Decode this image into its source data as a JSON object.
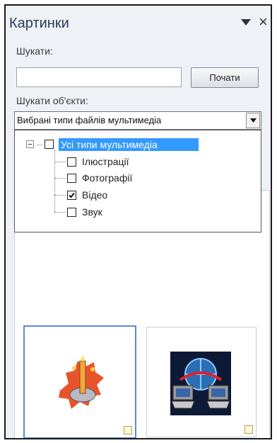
{
  "panel": {
    "title": "Картинки",
    "menu_icon": "chevron-down-icon",
    "close_icon": "close-icon",
    "close_glyph": "×"
  },
  "search": {
    "label": "Шукати:",
    "value": "",
    "placeholder": "",
    "go_button": "Почати"
  },
  "objects": {
    "label": "Шукати об'єкти:",
    "selected": "Вибрані типи файлів мультимедіа"
  },
  "tree": {
    "root": {
      "label": "Усі типи мультимедіа",
      "checked": false,
      "expanded": true,
      "selected": true
    },
    "items": [
      {
        "label": "Ілюстрації",
        "checked": false
      },
      {
        "label": "Фотографії",
        "checked": false
      },
      {
        "label": "Відео",
        "checked": true
      },
      {
        "label": "Звук",
        "checked": false
      }
    ]
  },
  "results": [
    {
      "icon": "clipart-illustration-icon",
      "selected": true
    },
    {
      "icon": "network-computers-icon",
      "selected": false
    }
  ],
  "colors": {
    "pane_bg": "#eef1f6",
    "title": "#2b3a55",
    "selection": "#3399ff",
    "selected_thumb_border": "#5b8ad0"
  }
}
